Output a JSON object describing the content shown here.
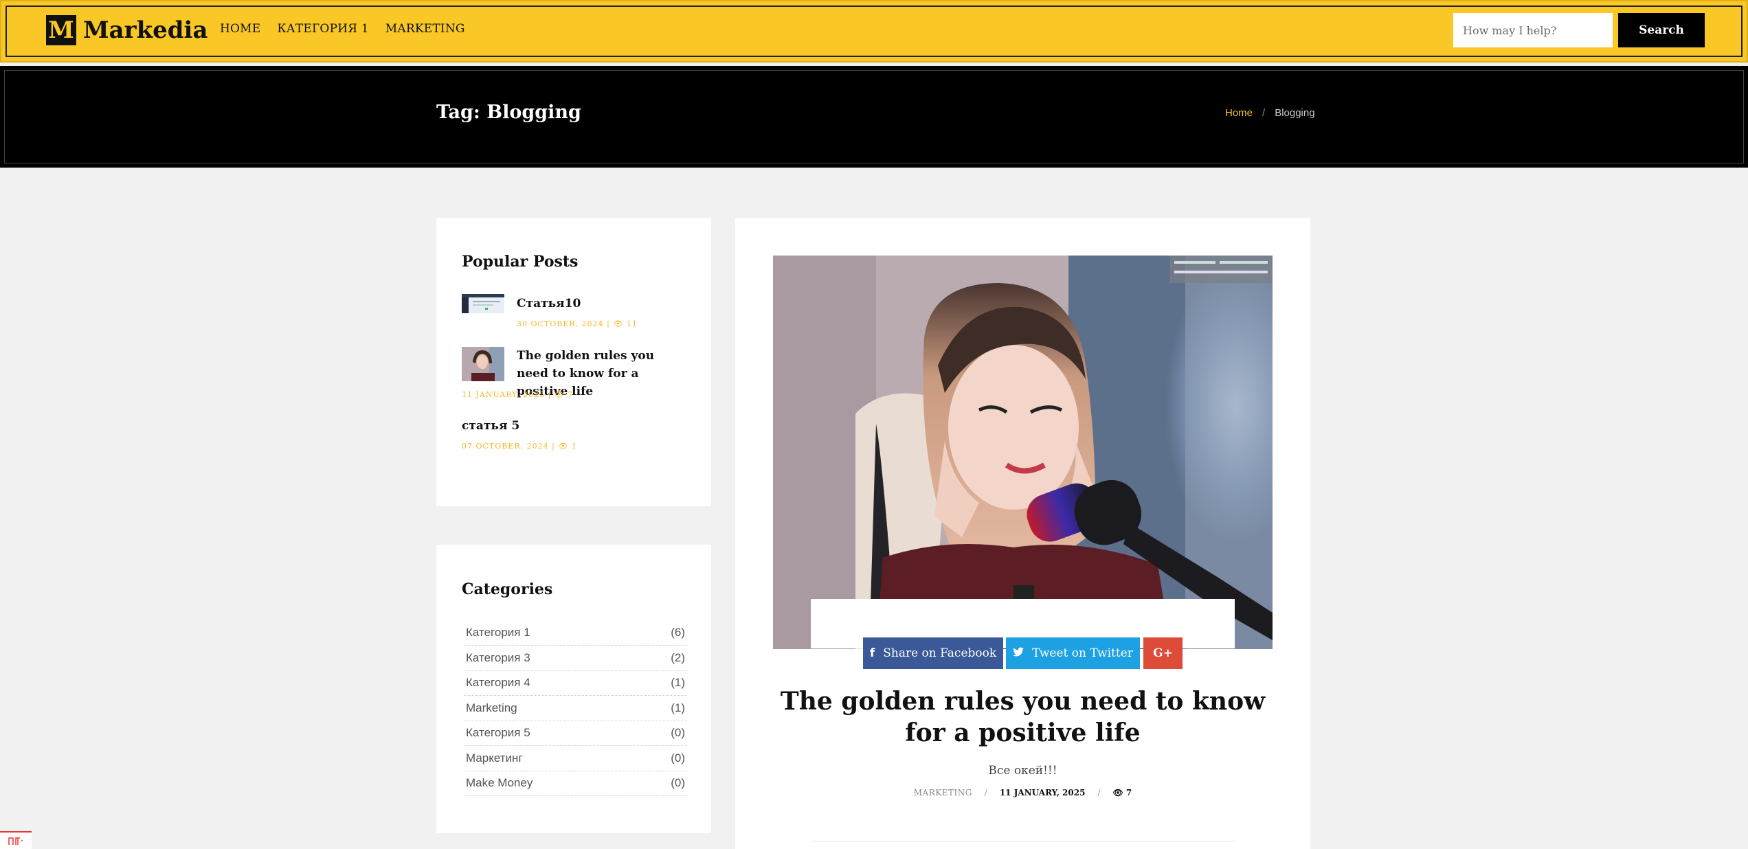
{
  "header": {
    "logo_letter": "M",
    "logo_text": "Markedia",
    "nav": [
      "HOME",
      "КАТЕГОРИЯ 1",
      "MARKETING"
    ],
    "search_placeholder": "How may I help?",
    "search_label": "Search"
  },
  "hero": {
    "title": "Tag: Blogging",
    "breadcrumb": {
      "home": "Home",
      "separator": "/",
      "current": "Blogging"
    }
  },
  "popular_posts": {
    "title": "Popular Posts",
    "items": [
      {
        "title": "Статья10",
        "meta": "30 OCTOBER, 2024 | 👁 11"
      },
      {
        "title": "The golden rules you need to know for a positive life",
        "meta": "11 JANUARY, 2025 | 👁 7"
      },
      {
        "title": "статья 5",
        "meta": "07 OCTOBER, 2024 | 👁 1"
      }
    ]
  },
  "categories": {
    "title": "Categories",
    "items": [
      {
        "name": "Категория 1",
        "count": "(6)"
      },
      {
        "name": "Категория 3",
        "count": "(2)"
      },
      {
        "name": "Категория 4",
        "count": "(1)"
      },
      {
        "name": "Marketing",
        "count": "(1)"
      },
      {
        "name": "Категория 5",
        "count": "(0)"
      },
      {
        "name": "Маркетинг",
        "count": "(0)"
      },
      {
        "name": "Make Money",
        "count": "(0)"
      }
    ]
  },
  "post": {
    "share_facebook": "Share on Facebook",
    "share_twitter": "Tweet on Twitter",
    "share_gplus": "G+",
    "title": "The golden rules you need to know for a positive life",
    "excerpt": "Все окей!!!",
    "category": "MARKETING",
    "date": "11 JANUARY, 2025",
    "views": "👁 7",
    "meta_sep": "/"
  },
  "colors": {
    "brand_yellow": "#f9c826",
    "facebook": "#3b5998",
    "twitter": "#1da1e2",
    "gplus": "#dd4b39"
  }
}
